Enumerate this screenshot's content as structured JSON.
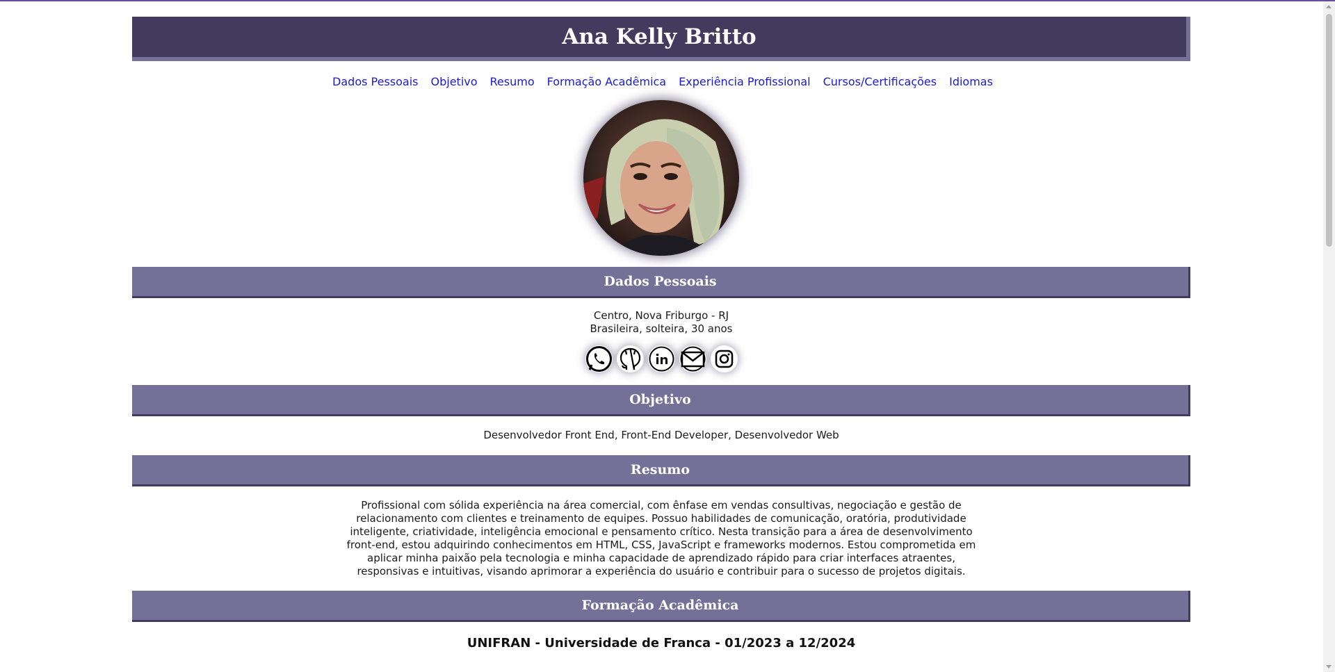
{
  "header": {
    "name": "Ana Kelly Britto"
  },
  "nav": [
    "Dados Pessoais",
    "Objetivo",
    "Resumo",
    "Formação Acadêmica",
    "Experiência Profissional",
    "Cursos/Certificações",
    "Idiomas"
  ],
  "profile_photo": {
    "icon": "profile-photo"
  },
  "sections": {
    "dados_pessoais": {
      "title": "Dados Pessoais",
      "line1": "Centro, Nova Friburgo - RJ",
      "line2": "Brasileira, solteira, 30 anos",
      "socials": [
        "whatsapp-icon",
        "github-icon",
        "linkedin-icon",
        "email-icon",
        "instagram-icon"
      ]
    },
    "objetivo": {
      "title": "Objetivo",
      "text": "Desenvolvedor Front End, Front-End Developer, Desenvolvedor Web"
    },
    "resumo": {
      "title": "Resumo",
      "text": "Profissional com sólida experiência na área comercial, com ênfase em vendas consultivas, negociação e gestão de relacionamento com clientes e treinamento de equipes. Possuo habilidades de comunicação, oratória, produtividade inteligente, criatividade, inteligência emocional e pensamento crítico. Nesta transição para a área de desenvolvimento front-end, estou adquirindo conhecimentos em HTML, CSS, JavaScript e frameworks modernos. Estou comprometida em aplicar minha paixão pela tecnologia e minha capacidade de aprendizado rápido para criar interfaces atraentes, responsivas e intuitivas, visando aprimorar a experiência do usuário e contribuir para o sucesso de projetos digitais."
    },
    "formacao": {
      "title": "Formação Acadêmica",
      "entry": "UNIFRAN - Universidade de Franca - 01/2023 a 12/2024"
    }
  },
  "colors": {
    "header_bg": "#433b5e",
    "section_bg": "#757097",
    "link": "#1a1ad6"
  }
}
